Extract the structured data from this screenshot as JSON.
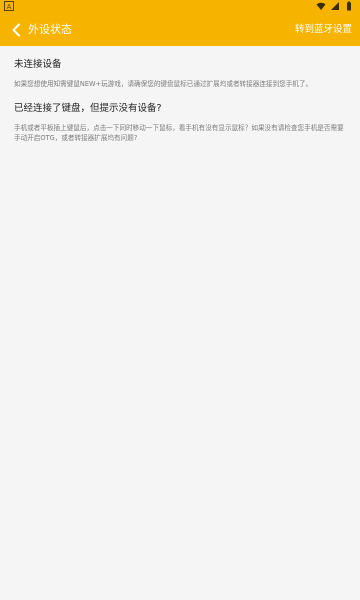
{
  "status_bar": {
    "left_badge": "A",
    "icons": [
      "wifi-icon",
      "signal-icon",
      "battery-icon"
    ]
  },
  "header": {
    "title": "外设状态",
    "action_label": "转到蓝牙设置",
    "back_icon": "chevron-left-icon"
  },
  "sections": [
    {
      "title": "未连接设备",
      "body": "如果您想使用知需键鼠NEW+玩游戏，请确保您的键盘鼠标已通过扩展坞或者转接器连接到您手机了。"
    },
    {
      "title": "已经连接了键盘，但提示没有设备?",
      "body": "手机或者平板插上键鼠后，点击一下同时移动一下鼠标，看手机有没有显示鼠标？如果没有请检查您手机是否需要手动开启OTG，或者转接器扩展坞有问题?"
    }
  ],
  "colors": {
    "accent": "#f6b400",
    "background": "#f5f5f5",
    "title_text": "#222222",
    "body_text": "#7a7a7a"
  }
}
